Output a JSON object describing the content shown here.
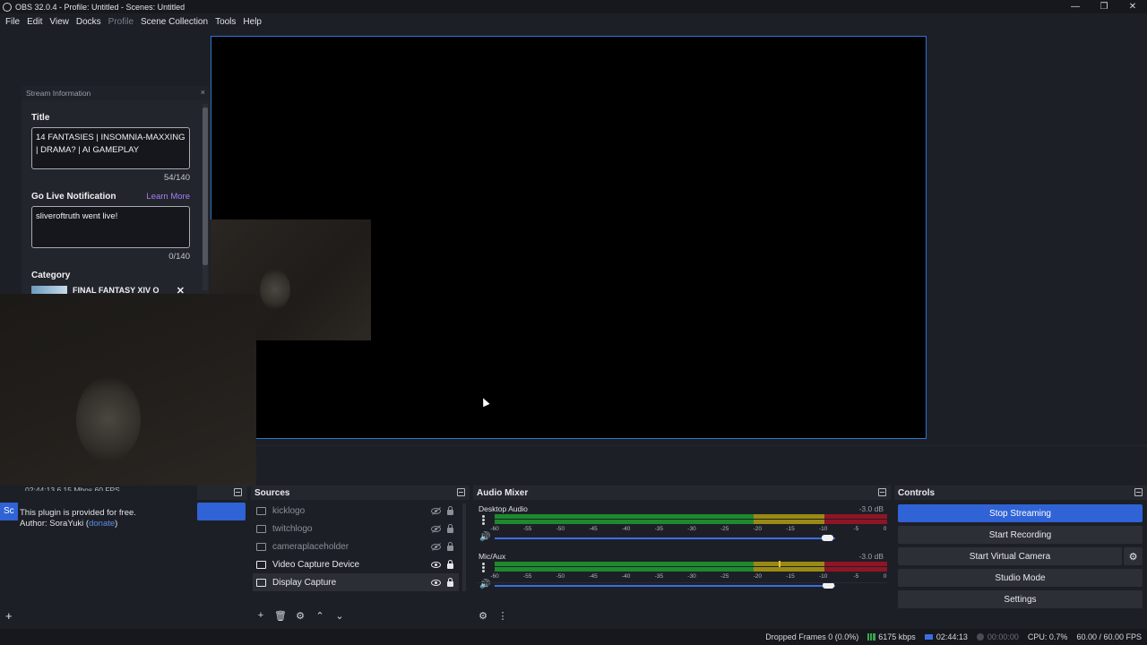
{
  "window": {
    "title": "OBS 32.0.4 - Profile: Untitled - Scenes: Untitled",
    "minimize": "—",
    "restore": "❐",
    "close": "✕"
  },
  "menu": [
    "File",
    "Edit",
    "View",
    "Docks",
    "Profile",
    "Scene Collection",
    "Tools",
    "Help"
  ],
  "menu_disabled": [
    "Profile"
  ],
  "stream_info": {
    "dock_title": "Stream Information",
    "close_glyph": "×",
    "title_label": "Title",
    "title_value": "14 FANTASIES | INSOMNIA-MAXXING | DRAMA? | AI GAMEPLAY",
    "title_counter": "54/140",
    "notif_label": "Go Live Notification",
    "learn_more": "Learn More",
    "notif_value": "sliveroftruth went live!",
    "notif_counter": "0/140",
    "category_label": "Category",
    "category_value": "FINAL FANTASY XIV O",
    "category_remove": "✕"
  },
  "scenes": {
    "header": "Sc",
    "selected_scene": "Sc",
    "add_button": "+"
  },
  "plugin": {
    "stats_text": "02:44:13  6.15 Mbps  60 FPS",
    "line1": "This plugin is provided for free.",
    "line2_prefix": "Author: SoraYuki (",
    "line2_link": "donate",
    "line2_suffix": ")"
  },
  "sources": {
    "header": "Sources",
    "items": [
      {
        "name": "kicklogo",
        "visible": false
      },
      {
        "name": "twitchlogo",
        "visible": false
      },
      {
        "name": "cameraplaceholder",
        "visible": false
      },
      {
        "name": "Video Capture Device",
        "visible": true
      },
      {
        "name": "Display Capture",
        "visible": true,
        "selected": true
      }
    ],
    "toolbar": [
      "+",
      "🗑",
      "⚙",
      "⌃",
      "⌄"
    ]
  },
  "mixer": {
    "header": "Audio Mixer",
    "channels": [
      {
        "name": "Desktop Audio",
        "db": "-3.0 dB",
        "volume": 0.97
      },
      {
        "name": "Mic/Aux",
        "db": "-3.0 dB",
        "volume": 0.97
      }
    ],
    "ticks": [
      "-60",
      "-55",
      "-50",
      "-45",
      "-40",
      "-35",
      "-30",
      "-25",
      "-20",
      "-15",
      "-10",
      "-5",
      "0"
    ],
    "toolbar": [
      "⚙",
      "⋮"
    ]
  },
  "controls": {
    "header": "Controls",
    "stop_streaming": "Stop Streaming",
    "start_recording": "Start Recording",
    "start_virtual_camera": "Start Virtual Camera",
    "studio_mode": "Studio Mode",
    "settings": "Settings",
    "gear_glyph": "⚙"
  },
  "status": {
    "dropped_frames": "Dropped Frames 0 (0.0%)",
    "bitrate": "6175 kbps",
    "stream_time": "02:44:13",
    "record_time": "00:00:00",
    "cpu": "CPU: 0.7%",
    "fps": "60.00 / 60.00 FPS"
  },
  "colors": {
    "accent": "#2f63d6",
    "preview_border": "#2f74d0",
    "background": "#1d1f26",
    "learn_more": "#a77ff5"
  }
}
